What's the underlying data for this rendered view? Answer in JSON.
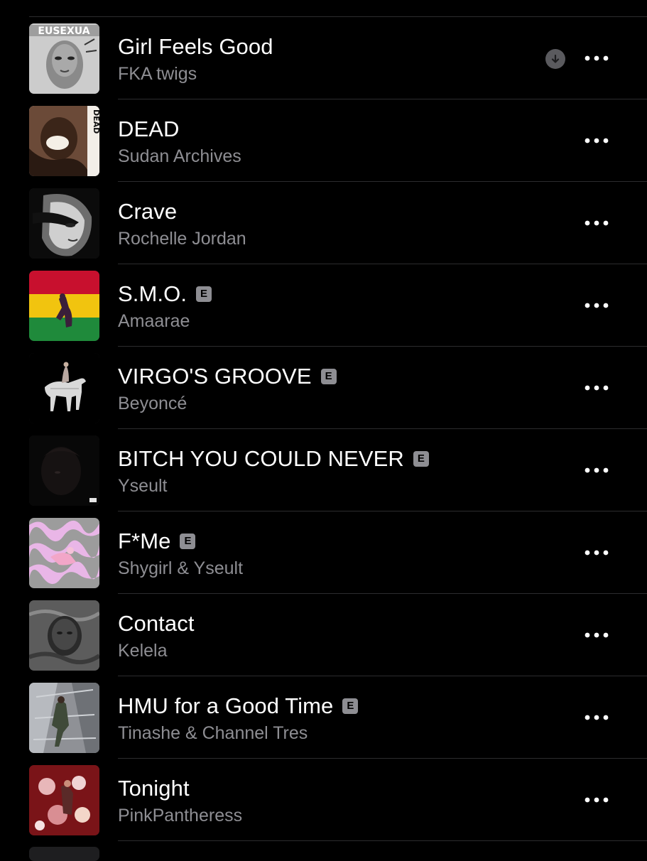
{
  "tracks": [
    {
      "title": "Girl Feels Good",
      "artist": "FKA twigs",
      "explicit": false,
      "downloaded": true,
      "artwork_text": "EUSEXUA",
      "artwork_colors": [
        "#cfcfcf",
        "#7a7a7a"
      ]
    },
    {
      "title": "DEAD",
      "artist": "Sudan Archives",
      "explicit": false,
      "downloaded": false,
      "artwork_text": "DEAD",
      "artwork_colors": [
        "#3b2a22",
        "#c9c1b8"
      ]
    },
    {
      "title": "Crave",
      "artist": "Rochelle Jordan",
      "explicit": false,
      "downloaded": false,
      "artwork_text": "",
      "artwork_colors": [
        "#0d0d0d",
        "#bfbfbf"
      ]
    },
    {
      "title": "S.M.O.",
      "artist": "Amaarae",
      "explicit": true,
      "downloaded": false,
      "artwork_text": "",
      "artwork_colors": [
        "#c8102e",
        "#f1c40f",
        "#1f8a3b"
      ]
    },
    {
      "title": "VIRGO'S GROOVE",
      "artist": "Beyoncé",
      "explicit": true,
      "downloaded": false,
      "artwork_text": "",
      "artwork_colors": [
        "#000000",
        "#d8d8d8"
      ]
    },
    {
      "title": "BITCH YOU COULD NEVER",
      "artist": "Yseult",
      "explicit": true,
      "downloaded": false,
      "artwork_text": "",
      "artwork_colors": [
        "#0a0a0a",
        "#2a2020"
      ]
    },
    {
      "title": "F*Me",
      "artist": "Shygirl & Yseult",
      "explicit": true,
      "downloaded": false,
      "artwork_text": "",
      "artwork_colors": [
        "#e7b8e6",
        "#9a9a9a"
      ]
    },
    {
      "title": "Contact",
      "artist": "Kelela",
      "explicit": false,
      "downloaded": false,
      "artwork_text": "",
      "artwork_colors": [
        "#4a4a4a",
        "#8a8a8a"
      ]
    },
    {
      "title": "HMU for a Good Time",
      "artist": "Tinashe & Channel Tres",
      "explicit": true,
      "downloaded": false,
      "artwork_text": "",
      "artwork_colors": [
        "#8d8f92",
        "#3d4a3a"
      ]
    },
    {
      "title": "Tonight",
      "artist": "PinkPantheress",
      "explicit": false,
      "downloaded": false,
      "artwork_text": "",
      "artwork_colors": [
        "#7a1418",
        "#e8b7b9"
      ]
    }
  ],
  "explicit_badge_label": "E",
  "icons": {
    "more": "ellipsis-icon",
    "download": "downloaded-arrow-icon"
  },
  "colors": {
    "background": "#000000",
    "title": "#ffffff",
    "subtitle": "#8e8e93",
    "divider": "#2c2c2e",
    "badge": "#8e8e93"
  }
}
